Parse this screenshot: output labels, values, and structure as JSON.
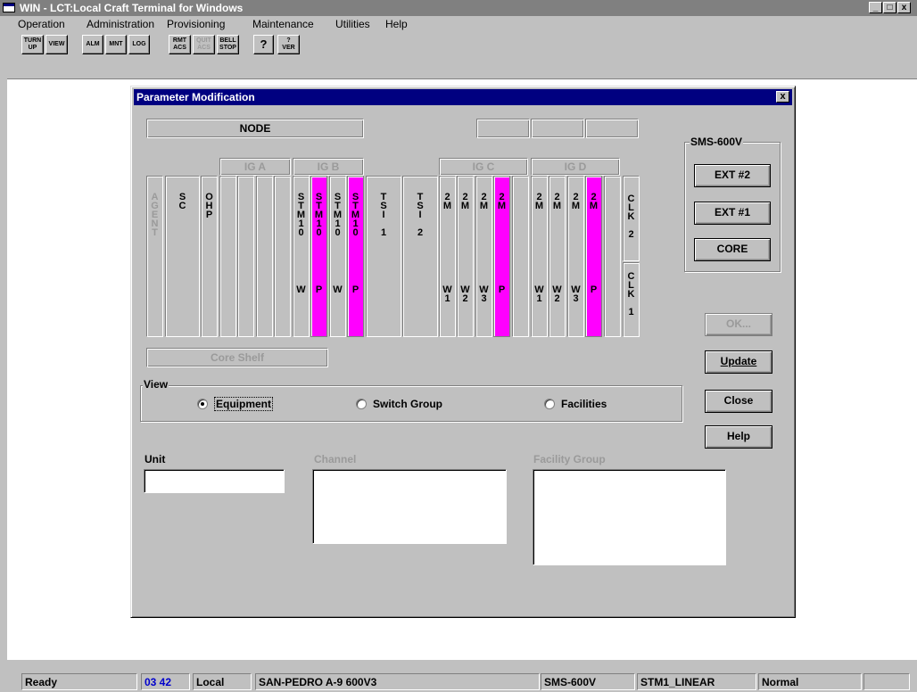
{
  "window": {
    "title": "WIN - LCT:Local Craft Terminal for Windows",
    "controls": [
      "_",
      "□",
      "x"
    ]
  },
  "menu": [
    "Operation",
    "Administration",
    "Provisioning",
    "Maintenance",
    "Utilities",
    "Help"
  ],
  "toolbar": [
    {
      "label": "TURN\nUP",
      "enabled": true
    },
    {
      "label": "VIEW",
      "enabled": true
    },
    {
      "label": "ALM",
      "enabled": true
    },
    {
      "label": "MNT",
      "enabled": true
    },
    {
      "label": "LOG",
      "enabled": true
    },
    {
      "label": "RMT\nACS",
      "enabled": true
    },
    {
      "label": "QUIT\nACS",
      "enabled": false
    },
    {
      "label": "BELL\nSTOP",
      "enabled": true
    },
    {
      "label": "?",
      "enabled": true
    },
    {
      "label": "?\nVER",
      "enabled": true
    }
  ],
  "dialog": {
    "title": "Parameter Modification",
    "close": "x",
    "node_label": "NODE",
    "groups": {
      "ig_a": "IG A",
      "ig_b": "IG B",
      "ig_c": "IG C",
      "ig_d": "IG D"
    },
    "core_shelf": "Core Shelf",
    "slots": [
      {
        "top": "AGENT",
        "bottom": "",
        "dim": true
      },
      {
        "top": "SC",
        "bottom": ""
      },
      {
        "top": "OHP",
        "bottom": ""
      },
      {
        "top": "",
        "bottom": ""
      },
      {
        "top": "",
        "bottom": ""
      },
      {
        "top": "",
        "bottom": ""
      },
      {
        "top": "",
        "bottom": ""
      },
      {
        "top": "STM10",
        "bottom": "W"
      },
      {
        "top": "STM10",
        "bottom": "P",
        "highlight": true
      },
      {
        "top": "STM10",
        "bottom": "W"
      },
      {
        "top": "STM10",
        "bottom": "P",
        "highlight": true
      },
      {
        "top": "TSI\n1",
        "bottom": "",
        "wide": true
      },
      {
        "top": "TSI\n2",
        "bottom": "",
        "wide": true
      },
      {
        "top": "2M",
        "bottom": "W1"
      },
      {
        "top": "2M",
        "bottom": "W2"
      },
      {
        "top": "2M",
        "bottom": "W3"
      },
      {
        "top": "2M",
        "bottom": "P",
        "highlight": true
      },
      {
        "top": "",
        "bottom": ""
      },
      {
        "top": "2M",
        "bottom": "W1"
      },
      {
        "top": "2M",
        "bottom": "W2"
      },
      {
        "top": "2M",
        "bottom": "W3"
      },
      {
        "top": "2M",
        "bottom": "P",
        "highlight": true
      },
      {
        "top": "",
        "bottom": ""
      }
    ],
    "clk2": "CLK\n2",
    "clk1": "CLK\n1",
    "sms": {
      "label": "SMS-600V",
      "buttons": [
        "EXT #2",
        "EXT #1",
        "CORE"
      ]
    },
    "buttons": {
      "ok": "OK...",
      "update": "Update",
      "close": "Close",
      "help": "Help"
    },
    "view": {
      "label": "View",
      "options": [
        {
          "label": "Equipment",
          "selected": true
        },
        {
          "label": "Switch Group",
          "selected": false
        },
        {
          "label": "Facilities",
          "selected": false
        }
      ]
    },
    "unit_label": "Unit",
    "unit_value": "",
    "channel_label": "Channel",
    "facility_label": "Facility Group"
  },
  "status": [
    "Ready",
    "03 42",
    "Local",
    "SAN-PEDRO A-9 600V3",
    "SMS-600V",
    "STM1_LINEAR",
    "Normal",
    ""
  ]
}
